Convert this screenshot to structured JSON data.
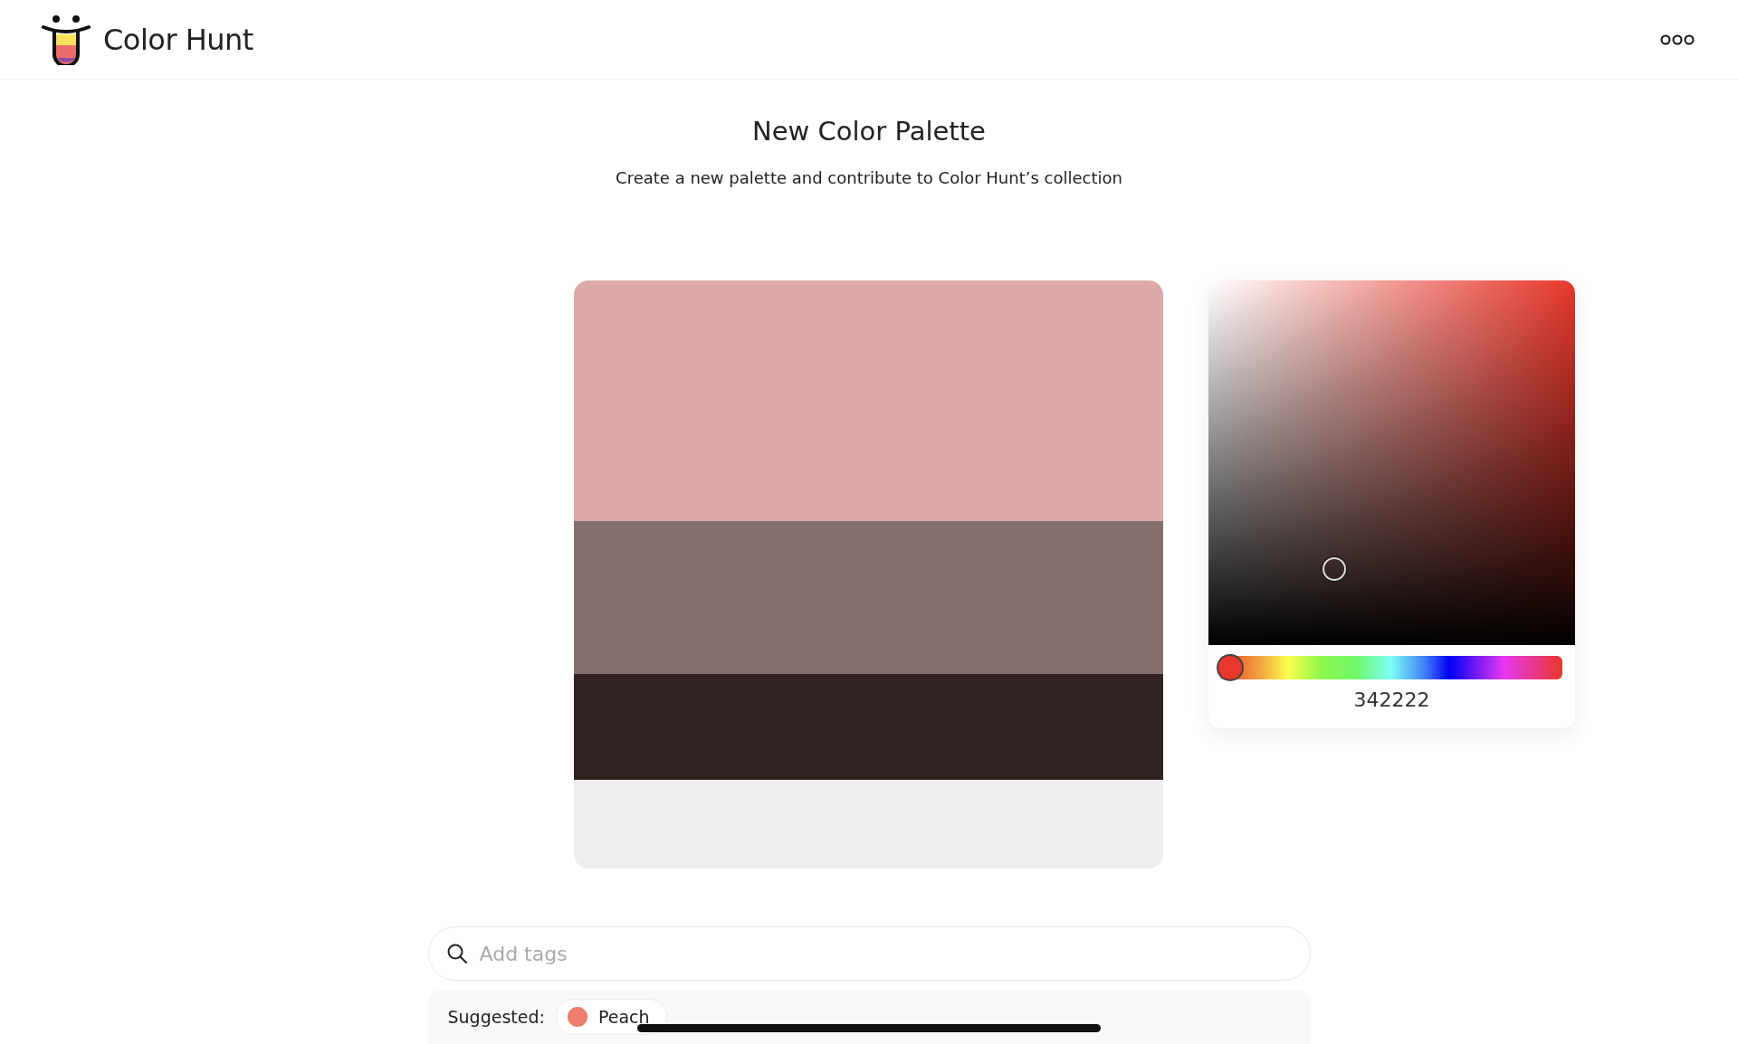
{
  "header": {
    "brand": "Color Hunt"
  },
  "page": {
    "title": "New Color Palette",
    "subtitle": "Create a new palette and contribute to Color Hunt’s collection"
  },
  "palette": [
    {
      "color": "#dbaaa8"
    },
    {
      "color": "#846e6c"
    },
    {
      "color": "#322222"
    },
    {
      "color": "#eeeeee"
    }
  ],
  "picker": {
    "hue": {
      "level": 0
    },
    "hex": "342222"
  },
  "tags": {
    "placeholder": "Add tags",
    "suggested_label": "Suggested:",
    "suggestions": [
      {
        "label": "Peach",
        "color": "#ee7d6d"
      }
    ]
  }
}
